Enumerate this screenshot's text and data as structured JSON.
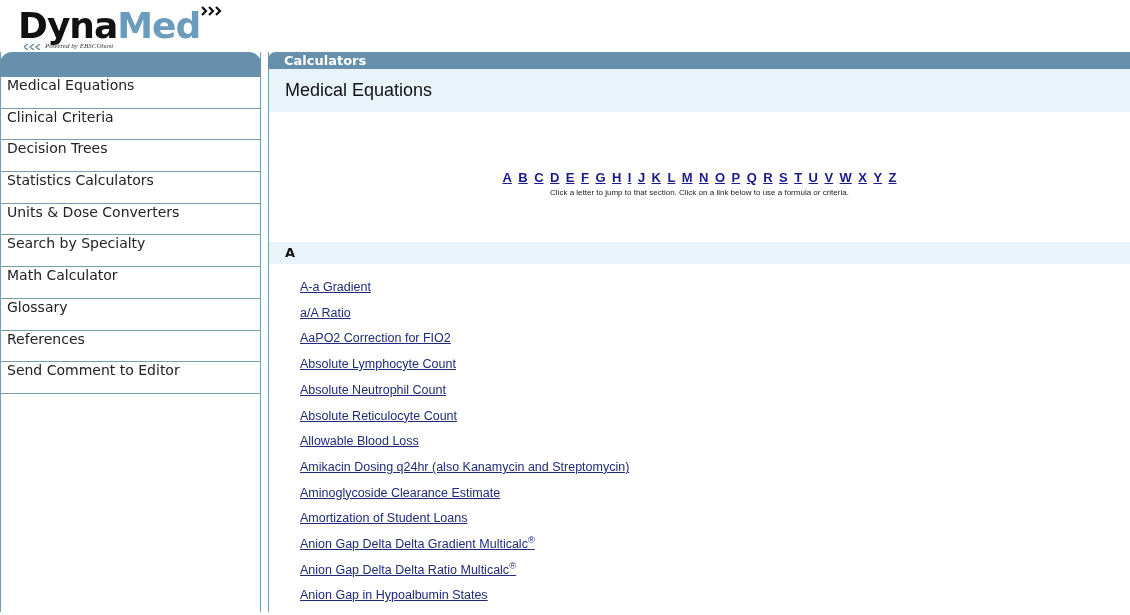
{
  "logo": {
    "first": "Dyna",
    "second": "Med",
    "tagline": "Powered by EBSCOhost"
  },
  "sidebar": {
    "items": [
      {
        "label": "Medical Equations",
        "selected": false
      },
      {
        "label": "Clinical Criteria",
        "selected": false
      },
      {
        "label": "Decision Trees",
        "selected": false
      },
      {
        "label": "Statistics Calculators",
        "selected": false
      },
      {
        "label": "Units & Dose Converters",
        "selected": false
      },
      {
        "label": "Search by Specialty",
        "selected": false
      },
      {
        "label": "Math Calculator",
        "selected": false
      },
      {
        "label": "Glossary",
        "selected": false
      },
      {
        "label": "References",
        "selected": false
      },
      {
        "label": "Send Comment to Editor",
        "selected": false
      }
    ]
  },
  "panel": {
    "header": "Calculators",
    "title": "Medical Equations",
    "letters": [
      "A",
      "B",
      "C",
      "D",
      "E",
      "F",
      "G",
      "H",
      "I",
      "J",
      "K",
      "L",
      "M",
      "N",
      "O",
      "P",
      "Q",
      "R",
      "S",
      "T",
      "U",
      "V",
      "W",
      "X",
      "Y",
      "Z"
    ],
    "hint": "Click a letter to jump to that section. Click on a link below to use a formula or criteria.",
    "sections": [
      {
        "heading": "A",
        "links": [
          "A-a Gradient",
          "a/A Ratio",
          "AaPO2 Correction for FIO2",
          "Absolute Lymphocyte Count",
          "Absolute Neutrophil Count",
          "Absolute Reticulocyte Count",
          "Allowable Blood Loss",
          "Amikacin Dosing q24hr (also Kanamycin and Streptomycin)",
          "Aminoglycoside Clearance Estimate",
          "Amortization of Student Loans",
          "Anion Gap Delta Delta Gradient Multicalc$^{®}$",
          "Anion Gap Delta Delta Ratio Multicalc$^{®}$",
          "Anion Gap in Hypoalbumin States"
        ]
      }
    ]
  }
}
